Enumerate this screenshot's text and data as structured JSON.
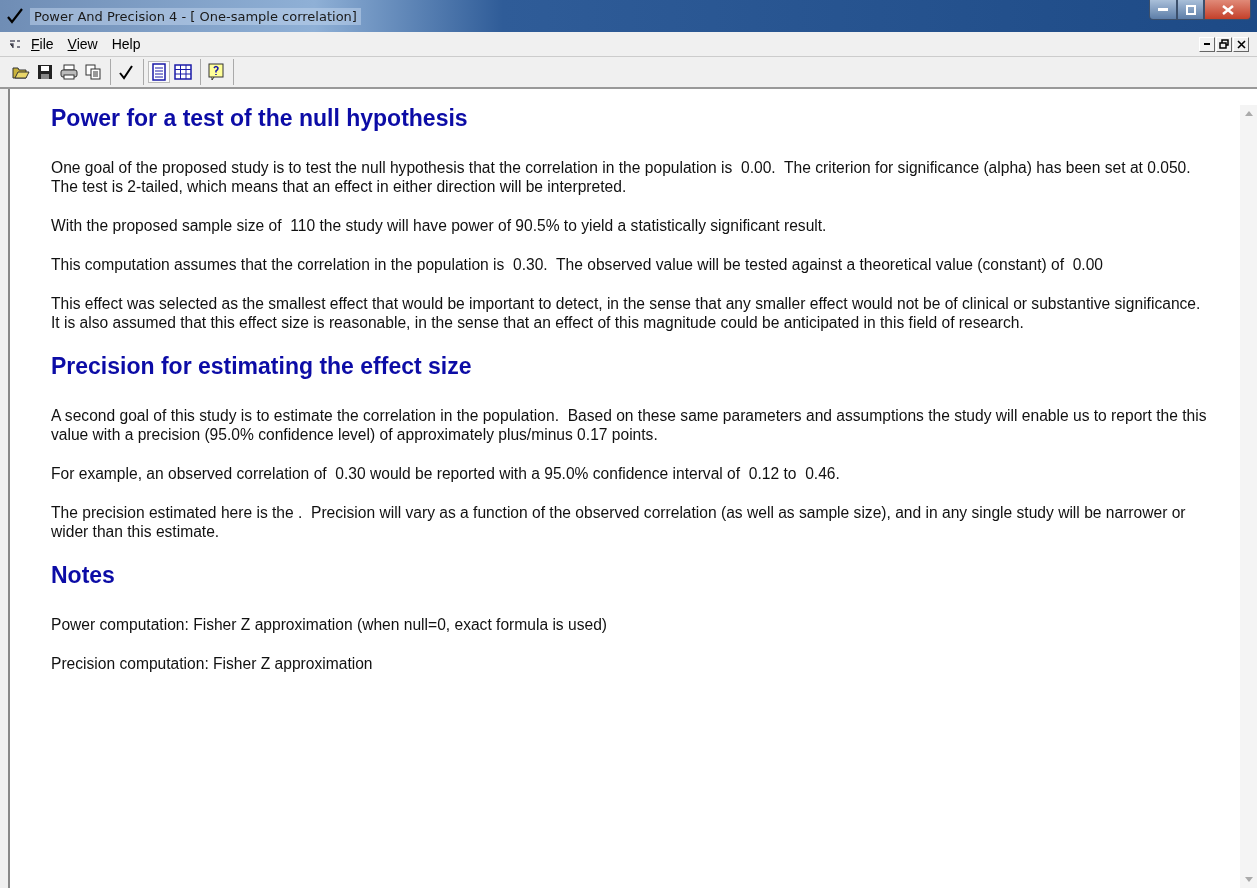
{
  "window": {
    "title": "Power And Precision 4 - [ One-sample correlation]"
  },
  "menu": [
    {
      "label": "File",
      "underlined": true
    },
    {
      "label": "View",
      "underlined": true
    },
    {
      "label": "Help",
      "underlined": false
    }
  ],
  "toolbar": {
    "file_tools": [
      {
        "kind": "open"
      },
      {
        "kind": "save"
      },
      {
        "kind": "print"
      },
      {
        "kind": "copy"
      }
    ],
    "action_tools": [
      {
        "kind": "check"
      }
    ],
    "views": [
      {
        "kind": "report",
        "selected": true
      },
      {
        "kind": "table",
        "selected": false
      }
    ],
    "help_tools": [
      {
        "kind": "help"
      }
    ]
  },
  "sections": [
    {
      "heading": "Power for a test of the null hypothesis",
      "paragraphs": [
        "One goal of the proposed study is to test the null hypothesis that the correlation in the population is  0.00.  The criterion for significance (alpha) has been set at 0.050.  The test is 2-tailed, which means that an effect in either direction will be interpreted.",
        "With the proposed sample size of  110 the study will have power of 90.5% to yield a statistically significant result.",
        "This computation assumes that the correlation in the population is  0.30.  The observed value will be tested against a theoretical value (constant) of  0.00",
        "This effect was selected as the smallest effect that would be important to detect, in the sense that any smaller effect would not be of clinical or substantive significance.  It is also assumed that this effect size is reasonable, in the sense that an effect of this magnitude could be anticipated in this field of research."
      ]
    },
    {
      "heading": "Precision for estimating the effect size",
      "paragraphs": [
        "A second goal of this study is to estimate the correlation in the population.  Based on these same parameters and assumptions the study will enable us to report the this value with a precision (95.0% confidence level) of approximately plus/minus 0.17 points.",
        "For example, an observed correlation of  0.30 would be reported with a 95.0% confidence interval of  0.12 to  0.46.",
        "The precision estimated here is the .  Precision will vary as a function of the observed correlation (as well as sample size), and in any single study will be narrower or wider than this estimate."
      ]
    },
    {
      "heading": "Notes",
      "paragraphs": [
        "Power computation: Fisher Z approximation (when null=0, exact formula is used)",
        "Precision computation: Fisher Z approximation"
      ]
    }
  ]
}
